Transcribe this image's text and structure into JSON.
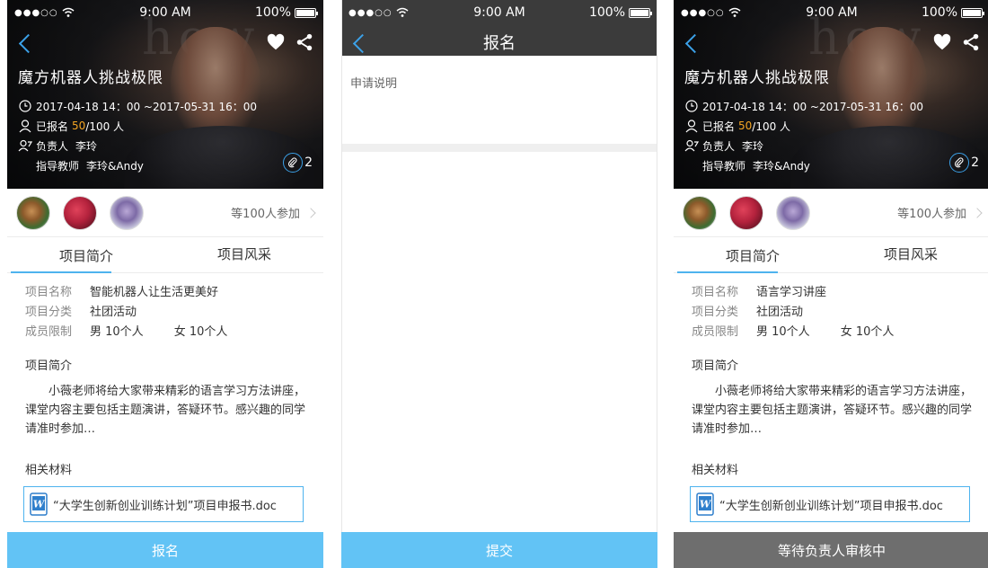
{
  "status": {
    "signal": "●●●○○",
    "wifi": "wifi-icon",
    "time": "9:00 AM",
    "battery": "100%"
  },
  "project_screen_1": {
    "title": "魔方机器人挑战极限",
    "time_range": "2017-04-18 14：00 ~2017-05-31 16：00",
    "enrolled_prefix": "已报名",
    "enrolled_count": "50",
    "enrolled_suffix": "/100 人",
    "owner_label": "负责人",
    "owner_name": "李玲",
    "teacher_label": "指导教师",
    "teacher_name": "李玲&Andy",
    "attachment_count": "2",
    "participants_more": "等100人参加",
    "tab_intro": "项目简介",
    "tab_style": "项目风采",
    "name_label": "项目名称",
    "name_value": "智能机器人让生活更美好",
    "category_label": "项目分类",
    "category_value": "社团活动",
    "limit_label": "成员限制",
    "limit_male": "男 10个人",
    "limit_female": "女 10个人",
    "intro_heading": "项目简介",
    "intro_text": "小薇老师将给大家带来精彩的语言学习方法讲座，课堂内容主要包括主题演讲，答疑环节。感兴趣的同学请准时参加…",
    "materials_heading": "相关材料",
    "doc_name": "“大学生创新创业训练计划”项目申报书.doc",
    "button_label": "报名"
  },
  "apply_screen": {
    "title": "报名",
    "apply_label": "申请说明",
    "submit_label": "提交"
  },
  "project_screen_3": {
    "title": "魔方机器人挑战极限",
    "time_range": "2017-04-18 14：00 ~2017-05-31 16：00",
    "enrolled_prefix": "已报名",
    "enrolled_count": "50",
    "enrolled_suffix": "/100 人",
    "owner_label": "负责人",
    "owner_name": "李玲",
    "teacher_label": "指导教师",
    "teacher_name": "李玲&Andy",
    "attachment_count": "2",
    "participants_more": "等100人参加",
    "tab_intro": "项目简介",
    "tab_style": "项目风采",
    "name_label": "项目名称",
    "name_value": "语言学习讲座",
    "category_label": "项目分类",
    "category_value": "社团活动",
    "limit_label": "成员限制",
    "limit_male": "男 10个人",
    "limit_female": "女 10个人",
    "intro_heading": "项目简介",
    "intro_text": "小薇老师将给大家带来精彩的语言学习方法讲座，课堂内容主要包括主题演讲，答疑环节。感兴趣的同学请准时参加…",
    "materials_heading": "相关材料",
    "doc_name": "“大学生创新创业训练计划”项目申报书.doc",
    "button_label": "等待负责人审核中"
  },
  "colors": {
    "accent": "#4eb3ee",
    "button_blue": "#62c3f5",
    "button_gray": "#6e6e6e",
    "highlight": "#f5a623",
    "apply_header": "#3b3b3b"
  }
}
